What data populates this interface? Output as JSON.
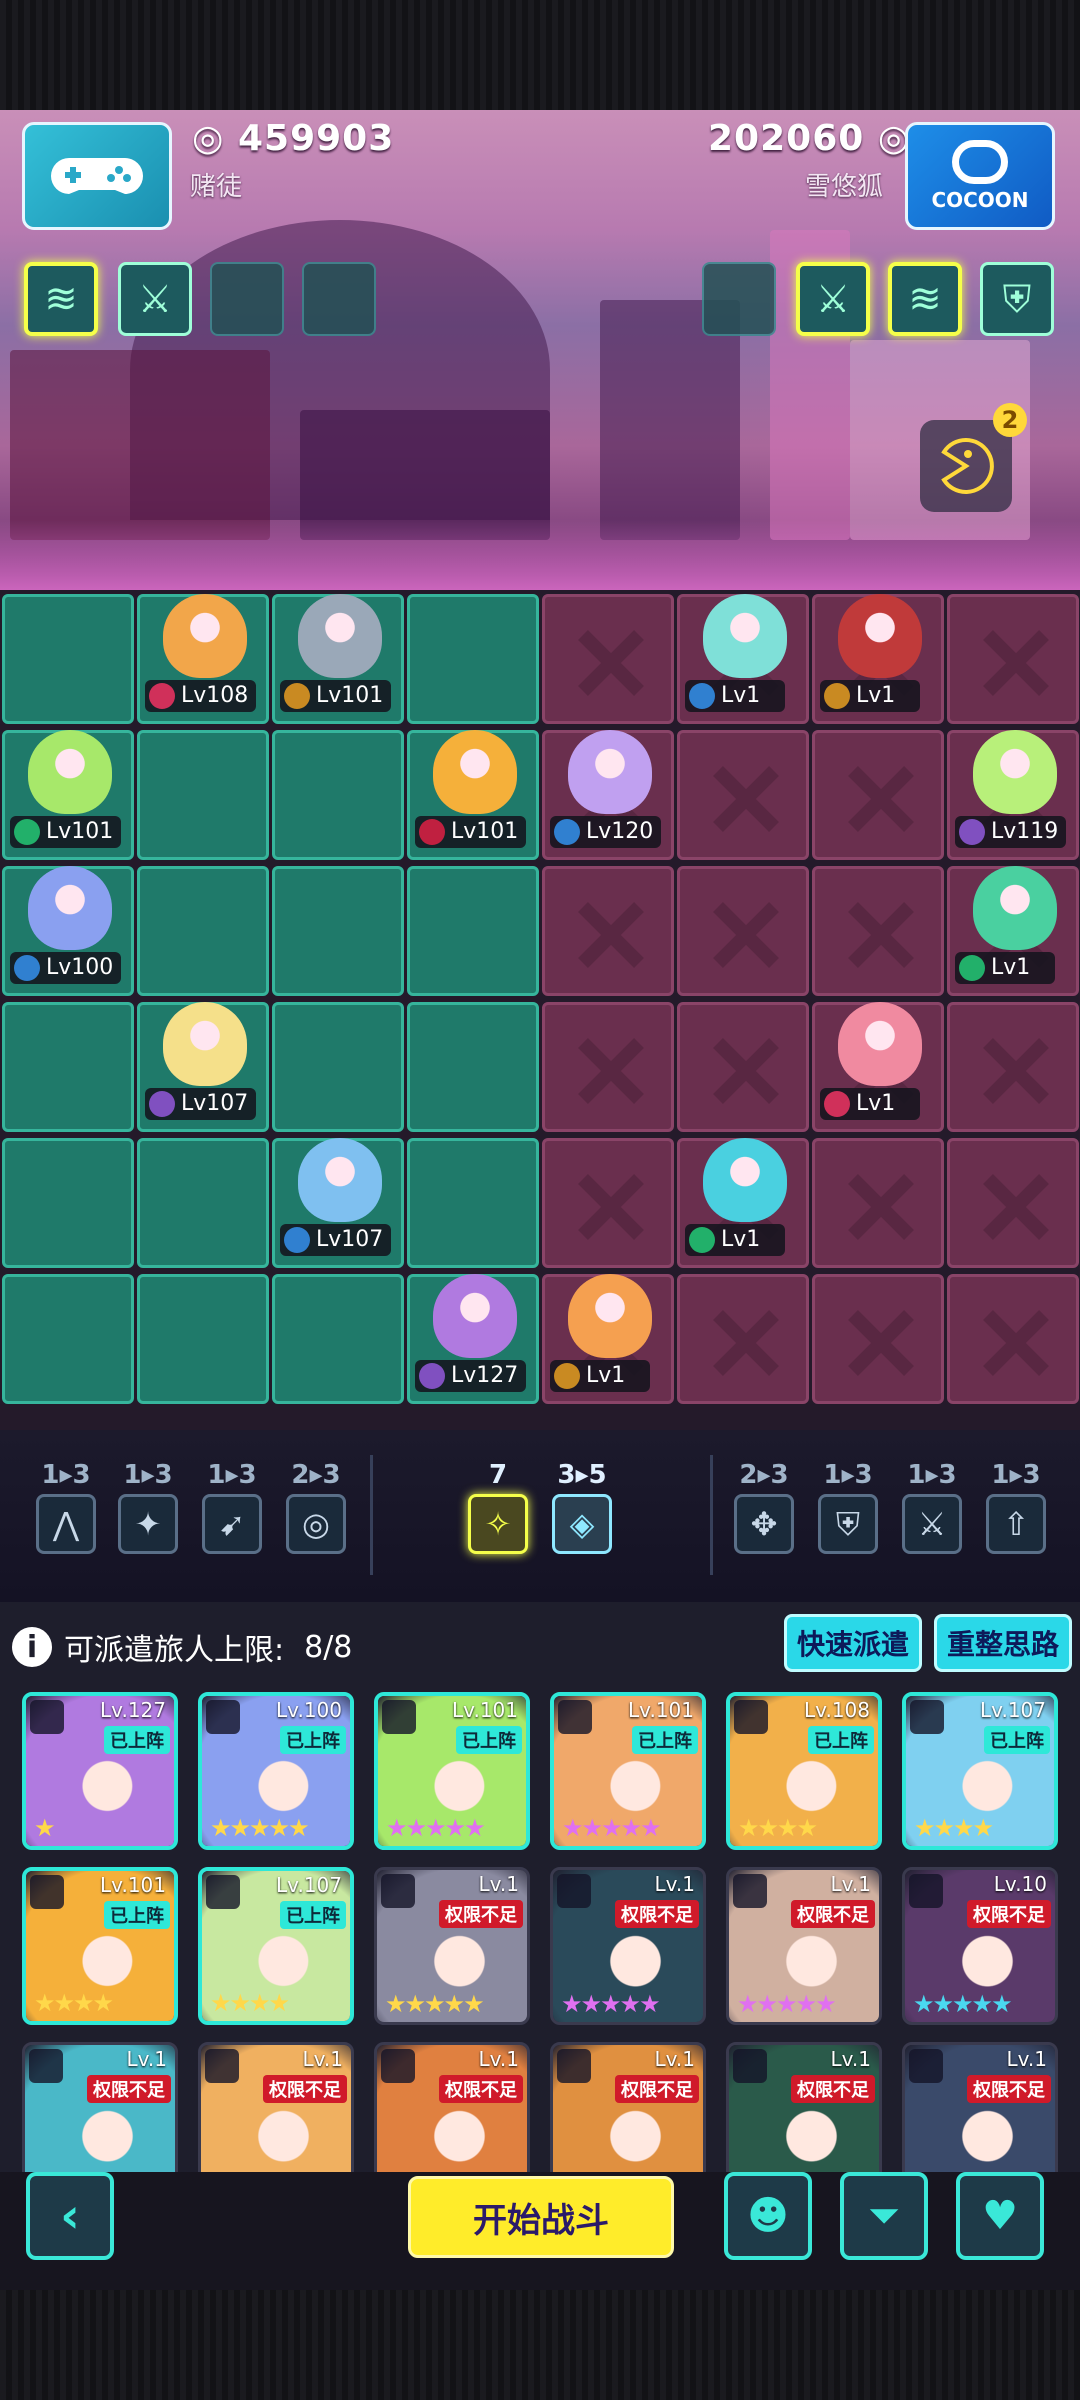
{
  "players": {
    "left": {
      "score": "459903",
      "name": "赌徒",
      "card_icon": "gamepad-icon"
    },
    "right": {
      "score": "202060",
      "name": "雪悠狐",
      "logo_text": "COCOON"
    }
  },
  "notification": {
    "count": "2",
    "icon": "pacman-icon"
  },
  "board": {
    "player_units": [
      {
        "level": "Lv108",
        "col": 1,
        "row": 0,
        "color": "#f2a64a",
        "class_color": "#d0305a"
      },
      {
        "level": "Lv101",
        "col": 2,
        "row": 0,
        "color": "#9aa8b8",
        "class_color": "#c98a22"
      },
      {
        "level": "Lv101",
        "col": 0,
        "row": 1,
        "color": "#a7e86a",
        "class_color": "#22b06a"
      },
      {
        "level": "Lv101",
        "col": 3,
        "row": 1,
        "color": "#f5b03a",
        "class_color": "#c02040"
      },
      {
        "level": "Lv100",
        "col": 0,
        "row": 2,
        "color": "#8aa0f0",
        "class_color": "#3080d0"
      },
      {
        "level": "Lv107",
        "col": 1,
        "row": 3,
        "color": "#f5e08a",
        "class_color": "#8050c0"
      },
      {
        "level": "Lv107",
        "col": 2,
        "row": 4,
        "color": "#7fc0f0",
        "class_color": "#3080d0"
      },
      {
        "level": "Lv127",
        "col": 3,
        "row": 5,
        "color": "#b07ae0",
        "class_color": "#8050c0"
      }
    ],
    "enemy_units": [
      {
        "level": "Lv1",
        "col": 1,
        "row": 0,
        "color": "#7fe0d8",
        "class_color": "#3080d0"
      },
      {
        "level": "Lv1",
        "col": 2,
        "row": 0,
        "color": "#c03a3a",
        "class_color": "#c98a22"
      },
      {
        "level": "Lv120",
        "col": 0,
        "row": 1,
        "color": "#c0a0f0",
        "class_color": "#3080d0"
      },
      {
        "level": "Lv119",
        "col": 3,
        "row": 1,
        "color": "#b8f07a",
        "class_color": "#8050c0"
      },
      {
        "level": "Lv1",
        "col": 3,
        "row": 2,
        "color": "#4ad0a0",
        "class_color": "#22b06a"
      },
      {
        "level": "Lv1",
        "col": 2,
        "row": 3,
        "color": "#f08aa0",
        "class_color": "#d0305a"
      },
      {
        "level": "Lv1",
        "col": 1,
        "row": 4,
        "color": "#4ad0e0",
        "class_color": "#22b06a"
      },
      {
        "level": "Lv1",
        "col": 0,
        "row": 5,
        "color": "#f5a050",
        "class_color": "#c98a22"
      }
    ]
  },
  "synergies": {
    "left": [
      {
        "count": "1▸3",
        "icon": "mountain-peak-icon"
      },
      {
        "count": "1▸3",
        "icon": "shuriken-icon"
      },
      {
        "count": "1▸3",
        "icon": "arrow-target-icon"
      },
      {
        "count": "2▸3",
        "icon": "swirl-icon"
      }
    ],
    "center": [
      {
        "count": "7",
        "icon": "sparkle-star-icon",
        "state": "gold"
      },
      {
        "count": "3▸5",
        "icon": "diamond-layers-icon",
        "state": "active"
      }
    ],
    "right": [
      {
        "count": "2▸3",
        "icon": "winged-crest-icon"
      },
      {
        "count": "1▸3",
        "icon": "shield-crest-icon"
      },
      {
        "count": "1▸3",
        "icon": "crossed-swords-icon"
      },
      {
        "count": "1▸3",
        "icon": "up-arrow-crest-icon"
      }
    ]
  },
  "roster": {
    "deploy_label": "可派遣旅人上限:",
    "deploy_value": "8/8",
    "quick_deploy": "快速派遣",
    "reset": "重整思路",
    "cards": [
      {
        "level": "Lv.127",
        "tag": "已上阵",
        "stars": "★",
        "star_color": "#ffd84a",
        "color": "#b07ae0",
        "state": "deployed"
      },
      {
        "level": "Lv.100",
        "tag": "已上阵",
        "stars": "★★★★★",
        "star_color": "#ffd84a",
        "color": "#8aa0f0",
        "state": "deployed"
      },
      {
        "level": "Lv.101",
        "tag": "已上阵",
        "stars": "★★★★★",
        "star_color": "#e070f0",
        "color": "#a7e86a",
        "state": "deployed"
      },
      {
        "level": "Lv.101",
        "tag": "已上阵",
        "stars": "★★★★★",
        "star_color": "#e070f0",
        "color": "#f0a86a",
        "state": "deployed"
      },
      {
        "level": "Lv.108",
        "tag": "已上阵",
        "stars": "★★★★",
        "star_color": "#ffd84a",
        "color": "#f2b04a",
        "state": "deployed"
      },
      {
        "level": "Lv.107",
        "tag": "已上阵",
        "stars": "★★★★",
        "star_color": "#ffd84a",
        "color": "#7fd0f0",
        "state": "deployed"
      },
      {
        "level": "Lv.101",
        "tag": "已上阵",
        "stars": "★★★★",
        "star_color": "#ffd84a",
        "color": "#f5b03a",
        "state": "deployed"
      },
      {
        "level": "Lv.107",
        "tag": "已上阵",
        "stars": "★★★★",
        "star_color": "#ffd84a",
        "color": "#c8e8a0",
        "state": "deployed"
      },
      {
        "level": "Lv.1",
        "tag": "权限不足",
        "stars": "★★★★★",
        "star_color": "#ffd84a",
        "color": "#8a8aa0",
        "state": "locked"
      },
      {
        "level": "Lv.1",
        "tag": "权限不足",
        "stars": "★★★★★",
        "star_color": "#e070f0",
        "color": "#2a4a5a",
        "state": "locked"
      },
      {
        "level": "Lv.1",
        "tag": "权限不足",
        "stars": "★★★★★",
        "star_color": "#e070f0",
        "color": "#d0b0a0",
        "state": "locked"
      },
      {
        "level": "Lv.10",
        "tag": "权限不足",
        "stars": "★★★★★",
        "star_color": "#4ad8f0",
        "color": "#5a3a6a",
        "state": "locked"
      },
      {
        "level": "Lv.1",
        "tag": "权限不足",
        "stars": "",
        "star_color": "#ffd84a",
        "color": "#4ab8c8",
        "state": "locked"
      },
      {
        "level": "Lv.1",
        "tag": "权限不足",
        "stars": "",
        "star_color": "#ffd84a",
        "color": "#f0b060",
        "state": "locked"
      },
      {
        "level": "Lv.1",
        "tag": "权限不足",
        "stars": "",
        "star_color": "#ffd84a",
        "color": "#e08040",
        "state": "locked"
      },
      {
        "level": "Lv.1",
        "tag": "权限不足",
        "stars": "",
        "star_color": "#ffd84a",
        "color": "#e09040",
        "state": "locked"
      },
      {
        "level": "Lv.1",
        "tag": "权限不足",
        "stars": "",
        "star_color": "#ffd84a",
        "color": "#2a5a4a",
        "state": "locked"
      },
      {
        "level": "Lv.1",
        "tag": "权限不足",
        "stars": "",
        "star_color": "#ffd84a",
        "color": "#3a4a6a",
        "state": "locked"
      }
    ]
  },
  "bottom": {
    "start_label": "开始战斗",
    "buttons": [
      "back-arrow-icon",
      "head-gear-icon",
      "filter-icon",
      "heart-tag-icon"
    ]
  },
  "colors": {
    "accent_cyan": "#2ad8e8",
    "accent_yellow": "#ffec2a",
    "player_tile": "#1f7a6a",
    "enemy_tile": "#6a2f4e"
  }
}
